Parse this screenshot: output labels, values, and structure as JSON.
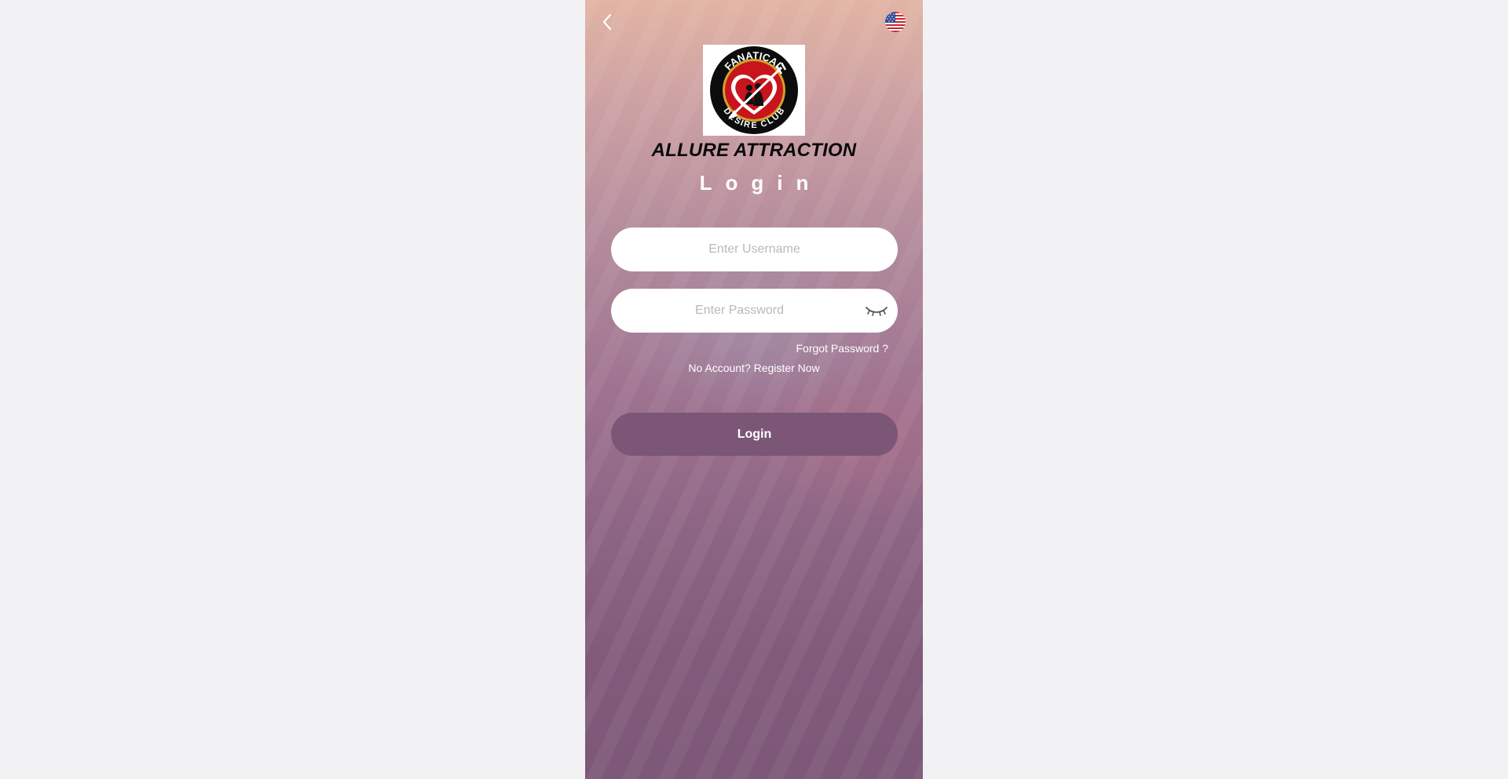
{
  "header": {
    "back_icon": "chevron-left-icon",
    "language_icon": "us-flag-icon"
  },
  "brand": {
    "name": "ALLURE ATTRACTION",
    "logo_text_top": "FANATICAL",
    "logo_text_bottom": "DESIRE CLUB"
  },
  "page": {
    "title": "Login"
  },
  "form": {
    "username_placeholder": "Enter Username",
    "username_value": "",
    "password_placeholder": "Enter Password",
    "password_value": "",
    "password_toggle_icon": "eye-closed-icon",
    "forgot_label": "Forgot Password ?",
    "register_label": "No Account? Register Now",
    "submit_label": "Login"
  },
  "colors": {
    "button": "#7c5676",
    "background_top": "#e2b4a4",
    "background_bottom": "#7d5878",
    "logo_red": "#c8141c"
  }
}
